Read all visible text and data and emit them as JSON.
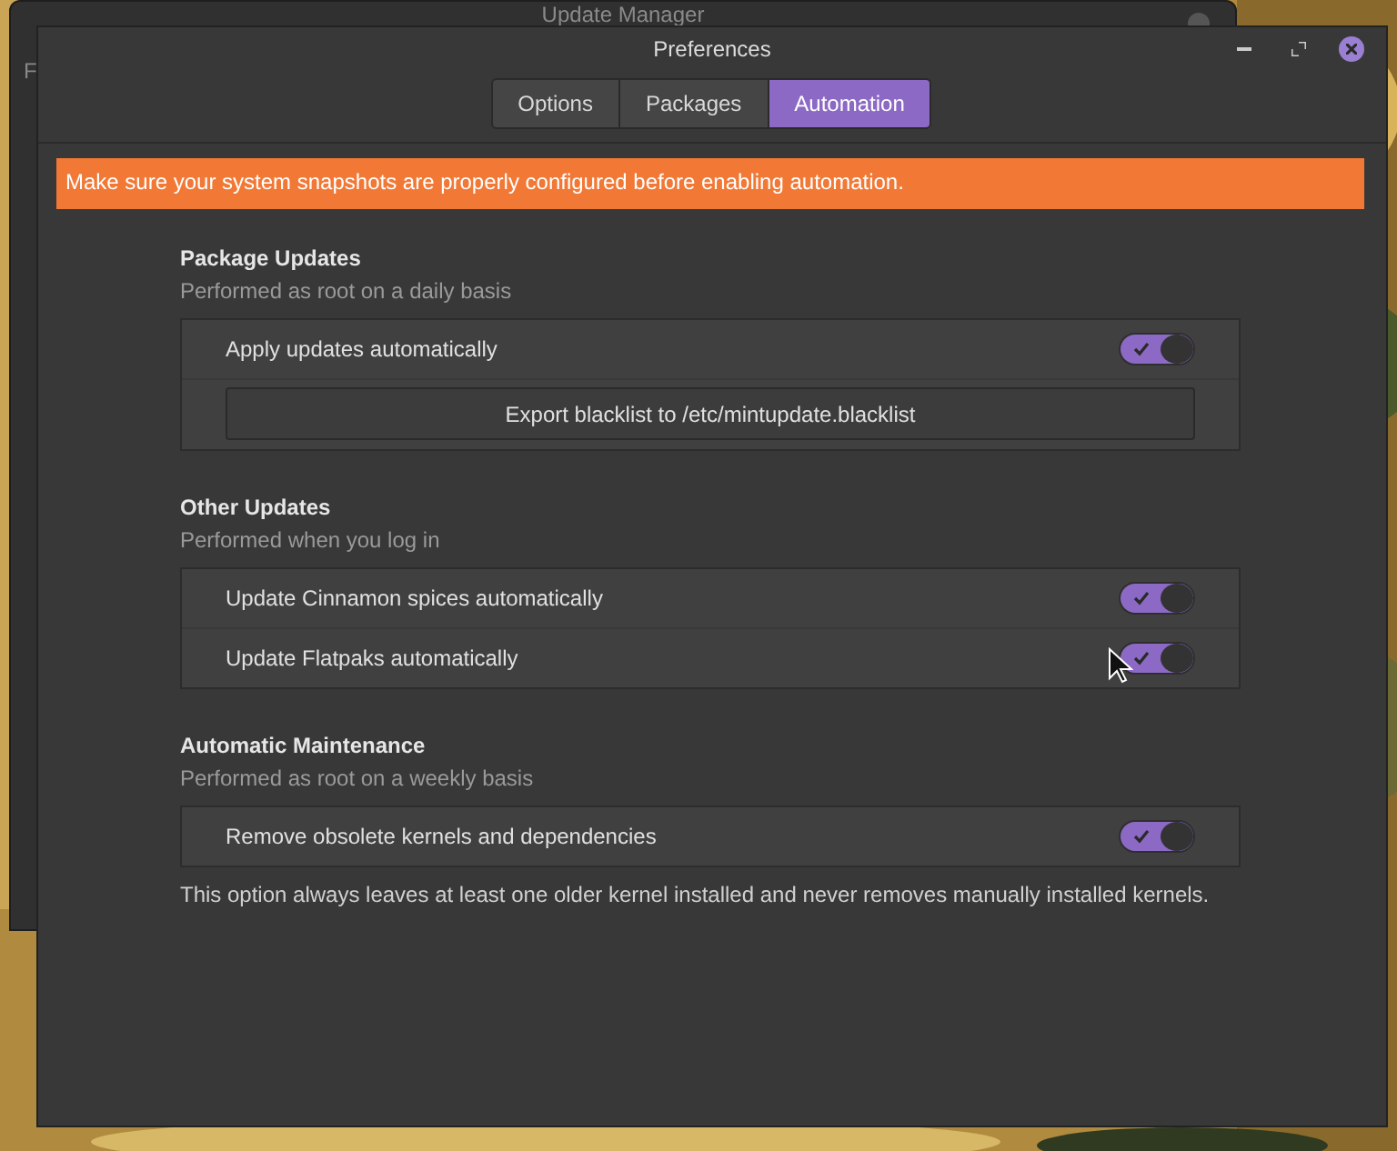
{
  "back_window": {
    "title": "Update Manager",
    "menu_text": "F"
  },
  "window": {
    "title": "Preferences"
  },
  "tabs": [
    {
      "label": "Options",
      "selected": false
    },
    {
      "label": "Packages",
      "selected": false
    },
    {
      "label": "Automation",
      "selected": true
    }
  ],
  "banner": "Make sure your system snapshots are properly configured before enabling automation.",
  "sections": [
    {
      "title": "Package Updates",
      "subtitle": "Performed as root on a daily basis",
      "rows": [
        {
          "kind": "toggle",
          "label": "Apply updates automatically",
          "on": true
        },
        {
          "kind": "button",
          "label": "Export blacklist to /etc/mintupdate.blacklist"
        }
      ]
    },
    {
      "title": "Other Updates",
      "subtitle": "Performed when you log in",
      "rows": [
        {
          "kind": "toggle",
          "label": "Update Cinnamon spices automatically",
          "on": true
        },
        {
          "kind": "toggle",
          "label": "Update Flatpaks automatically",
          "on": true
        }
      ]
    },
    {
      "title": "Automatic Maintenance",
      "subtitle": "Performed as root on a weekly basis",
      "rows": [
        {
          "kind": "toggle",
          "label": "Remove obsolete kernels and dependencies",
          "on": true
        }
      ]
    }
  ],
  "note": "This option always leaves at least one older kernel installed and never removes manually installed kernels."
}
